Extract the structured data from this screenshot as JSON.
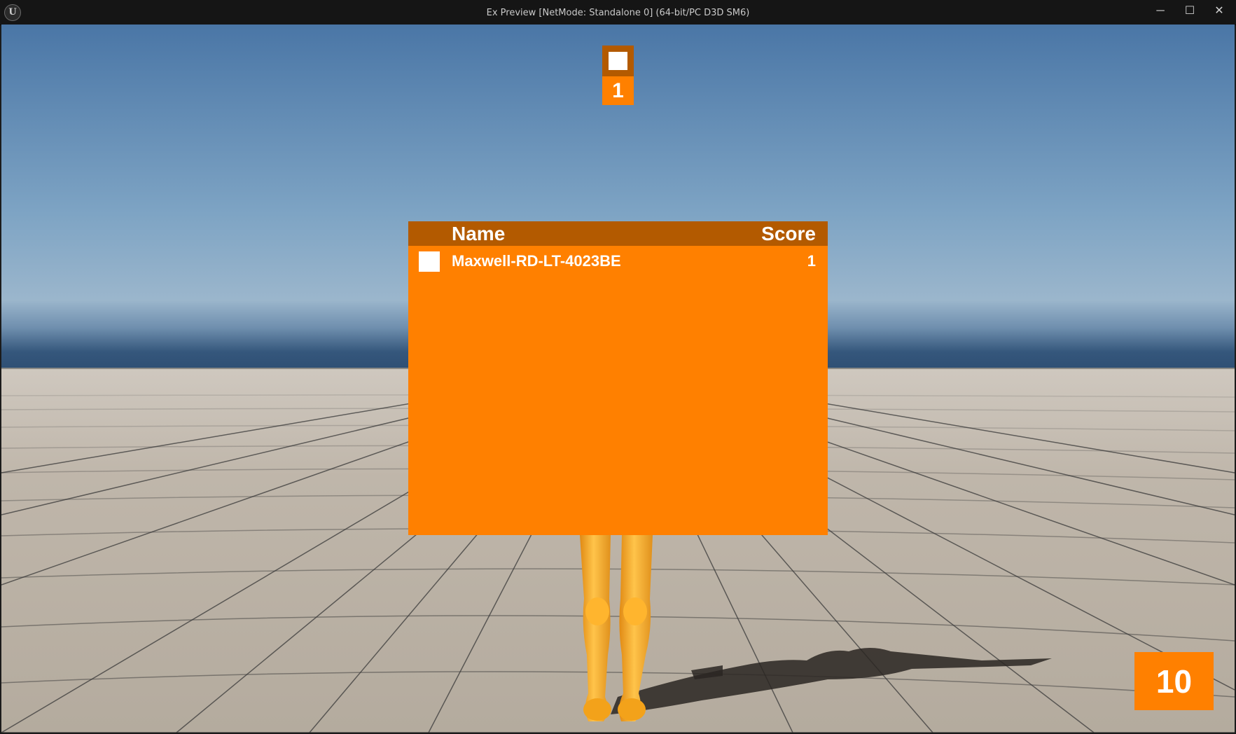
{
  "window": {
    "title": "Ex Preview [NetMode: Standalone 0]  (64-bit/PC D3D SM6)",
    "logo_glyph": "U",
    "minimize_glyph": "─",
    "maximize_glyph": "☐",
    "close_glyph": "✕"
  },
  "hud": {
    "top_swatch_color": "#ffffff",
    "top_score": "1",
    "timer": "10"
  },
  "scoreboard": {
    "header": {
      "name_label": "Name",
      "score_label": "Score"
    },
    "rows": [
      {
        "swatch_color": "#ffffff",
        "name": "Maxwell-RD-LT-4023BE",
        "score": "1"
      }
    ]
  },
  "colors": {
    "accent": "#ff8000",
    "accent_dark": "#b35a00",
    "sky_top": "#4e7aa8",
    "floor": "#bdb4a8"
  }
}
